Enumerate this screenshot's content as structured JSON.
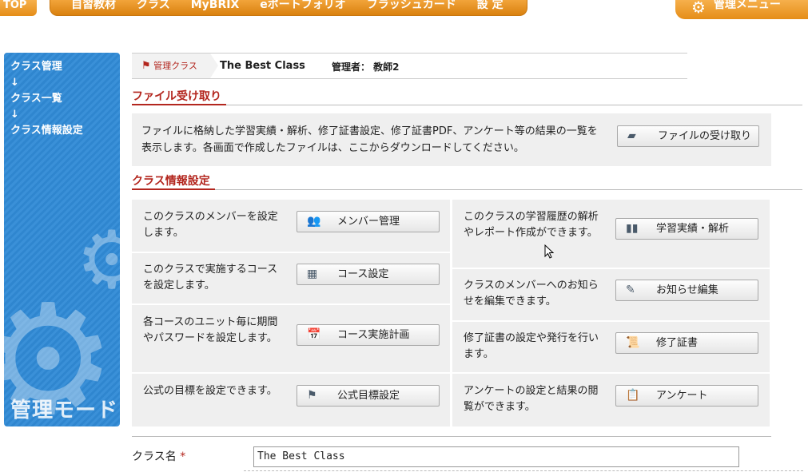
{
  "topnav": {
    "top_label": "TOP",
    "items": [
      "自習教材",
      "クラス",
      "MyBRIX",
      "eポートフォリオ",
      "フラッシュカード",
      "設 定"
    ],
    "admin_menu": "管理メニュー"
  },
  "sidebar": {
    "crumbs": [
      "クラス管理",
      "↓",
      "クラス一覧",
      "↓",
      "クラス情報設定"
    ],
    "mode_label": "管理モード"
  },
  "breadcrumb": {
    "tab_label": "管理クラス",
    "class_name": "The Best Class",
    "admin": "管理者： 教師2"
  },
  "sections": {
    "file_title": "ファイル受け取り",
    "class_title": "クラス情報設定"
  },
  "file_box": {
    "description": "ファイルに格納した学習実績・解析、修了証書設定、修了証書PDF、アンケート等の結果の一覧を表示します。各画面で作成したファイルは、ここからダウンロードしてください。",
    "button_label": "ファイルの受け取り"
  },
  "settings_left": [
    {
      "text": "このクラスのメンバーを設定します。",
      "button": "メンバー管理",
      "icon": "members-icon"
    },
    {
      "text": "このクラスで実施するコースを設定します。",
      "button": "コース設定",
      "icon": "course-icon"
    },
    {
      "text": "各コースのユニット毎に期間やパスワードを設定します。",
      "button": "コース実施計画",
      "icon": "calendar-icon"
    },
    {
      "text": "公式の目標を設定できます。",
      "button": "公式目標設定",
      "icon": "flag-icon"
    }
  ],
  "settings_right": [
    {
      "text": "このクラスの学習履歴の解析やレポート作成ができます。",
      "button": "学習実績・解析",
      "icon": "bar-chart-icon"
    },
    {
      "text": "クラスのメンバーへのお知らせを編集できます。",
      "button": "お知らせ編集",
      "icon": "notice-icon"
    },
    {
      "text": "修了証書の設定や発行を行います。",
      "button": "修了証書",
      "icon": "certificate-icon"
    },
    {
      "text": "アンケートの設定と結果の閲覧ができます。",
      "button": "アンケート",
      "icon": "clipboard-icon"
    }
  ],
  "form": {
    "class_name_label": "クラス名",
    "required_mark": "*",
    "class_name_value": "The Best Class"
  },
  "colors": {
    "accent_orange": "#e58d17",
    "heading_red": "#b3261e",
    "sidebar_blue": "#2f86cf"
  }
}
